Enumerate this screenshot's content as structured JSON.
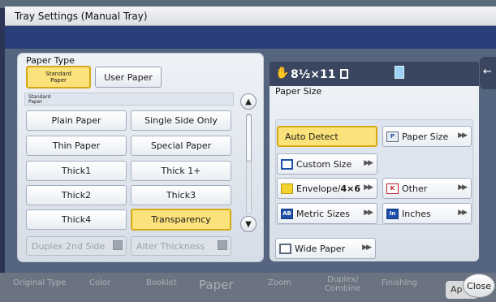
{
  "dialog": {
    "title": "Tray Settings (Manual Tray)",
    "close_label": "Close"
  },
  "left": {
    "section_label": "Paper Type",
    "tabs": {
      "standard_label": "Standard Paper",
      "user_label": "User Paper",
      "selected": "Standard Paper"
    },
    "strip_label": "Standard Paper",
    "paper_types": [
      {
        "label": "Plain Paper"
      },
      {
        "label": "Single Side Only"
      },
      {
        "label": "Thin Paper"
      },
      {
        "label": "Special Paper"
      },
      {
        "label": "Thick1"
      },
      {
        "label": "Thick 1+"
      },
      {
        "label": "Thick2"
      },
      {
        "label": "Thick3"
      },
      {
        "label": "Thick4"
      },
      {
        "label": "Transparency",
        "selected": true
      }
    ],
    "disabled": {
      "duplex_label": "Duplex 2nd Side",
      "alter_label": "Alter Thickness"
    }
  },
  "right": {
    "current_size": "8½×11",
    "section_label": "Paper Size",
    "sizes": {
      "auto_detect": "Auto Detect",
      "paper_size": "Paper Size",
      "custom_size": "Custom Size",
      "envelope_prefix": "Envelope/",
      "envelope_suffix": "4×6",
      "other": "Other",
      "metric_sizes": "Metric Sizes",
      "inches": "Inches",
      "wide_paper": "Wide Paper"
    },
    "selected": "Auto Detect"
  },
  "background": {
    "bottom_tabs": [
      "Original Type",
      "Color",
      "Booklet",
      "Paper",
      "Zoom",
      "Duplex/\nCombine",
      "Finishing"
    ],
    "ap_label": "Ap"
  },
  "colors": {
    "selected_fill": "#fbe27a",
    "selected_border": "#d4a915",
    "header_dark": "#3a4660",
    "band_blue": "#2a3f7a"
  }
}
